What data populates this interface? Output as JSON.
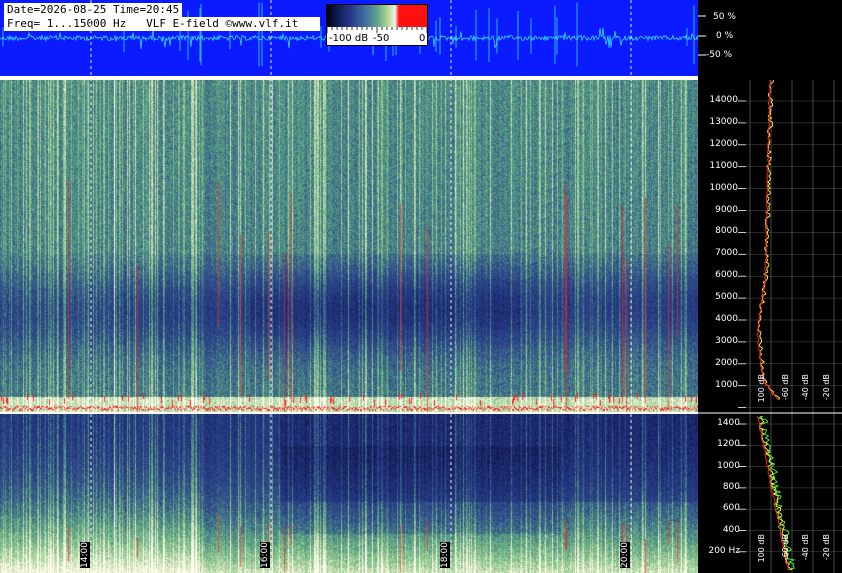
{
  "header": {
    "line1": "Date=2026-08-25 Time=20:45",
    "line2": "Freq= 1...15000 Hz   VLF E-field ©www.vlf.it"
  },
  "colorbar": {
    "labels": [
      "-100 dB",
      "-50",
      "0"
    ]
  },
  "waveform_scale": [
    "50 %",
    "0 %",
    "-50 %"
  ],
  "top_freq_axis": [
    "14000",
    "13000",
    "12000",
    "11000",
    "10000",
    "9000",
    "8000",
    "7000",
    "6000",
    "5000",
    "4000",
    "3000",
    "2000",
    "1000"
  ],
  "bottom_freq_axis": [
    "1400",
    "1200",
    "1000",
    "800",
    "600",
    "400",
    "200 Hz"
  ],
  "db_axis_top": [
    "100 dB",
    "-60 dB",
    "-40 dB",
    "-20 dB"
  ],
  "db_axis_bottom": [
    "100 dB",
    "-60 dB",
    "-40 dB",
    "-20 dB"
  ],
  "time_labels": [
    "14:00",
    "16:00",
    "18:00",
    "20:00"
  ],
  "colors": {
    "wave_bg": "#0a1cff",
    "signal": "#34d6ff",
    "accent_red": "#ff1010"
  }
}
